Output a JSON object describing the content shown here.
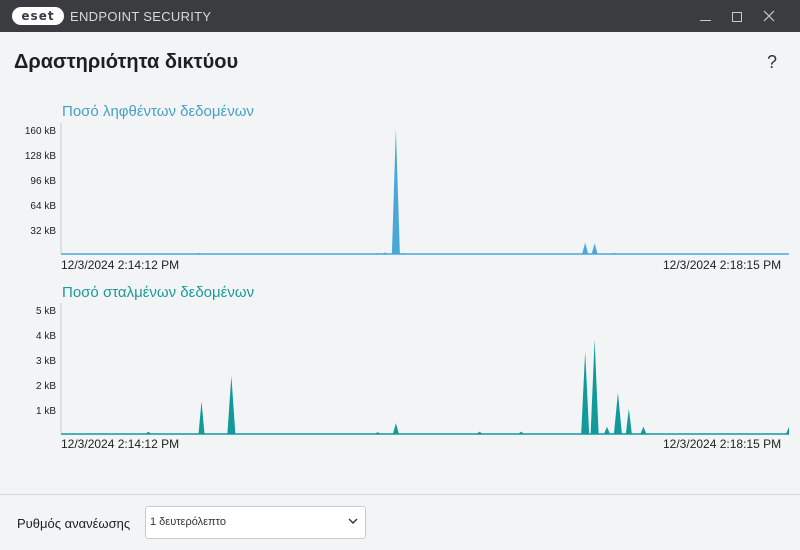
{
  "window": {
    "logo_text": "eset",
    "app_title": "ENDPOINT SECURITY",
    "minimize_icon": "minimize-icon",
    "maximize_icon": "maximize-icon",
    "close_icon": "close-icon"
  },
  "page": {
    "title": "Δραστηριότητα δικτύου",
    "help_label": "?"
  },
  "charts": {
    "received": {
      "title": "Ποσό ληφθέντων δεδομένων",
      "color": "#4aa8d6",
      "y_ticks": [
        "160 kB",
        "128 kB",
        "96 kB",
        "64 kB",
        "32 kB"
      ],
      "start_time": "12/3/2024 2:14:12 PM",
      "end_time": "12/3/2024 2:18:15 PM"
    },
    "sent": {
      "title": "Ποσό σταλμένων δεδομένων",
      "color": "#12999b",
      "y_ticks": [
        "5 kB",
        "4 kB",
        "3 kB",
        "2 kB",
        "1 kB"
      ],
      "start_time": "12/3/2024 2:14:12 PM",
      "end_time": "12/3/2024 2:18:15 PM"
    }
  },
  "chart_data": [
    {
      "type": "area",
      "title": "Ποσό ληφθέντων δεδομένων",
      "unit": "kB",
      "ylim": [
        0,
        160
      ],
      "x_start": "12/3/2024 2:14:12 PM",
      "x_end": "12/3/2024 2:18:15 PM",
      "peaks": [
        {
          "t": 0.19,
          "v": 1.5
        },
        {
          "t": 0.215,
          "v": 0.8
        },
        {
          "t": 0.235,
          "v": 0.6
        },
        {
          "t": 0.295,
          "v": 0.6
        },
        {
          "t": 0.435,
          "v": 1.5
        },
        {
          "t": 0.445,
          "v": 2
        },
        {
          "t": 0.46,
          "v": 166
        },
        {
          "t": 0.47,
          "v": 1.5
        },
        {
          "t": 0.71,
          "v": 0.8
        },
        {
          "t": 0.72,
          "v": 15
        },
        {
          "t": 0.733,
          "v": 14
        },
        {
          "t": 0.76,
          "v": 1.5
        },
        {
          "t": 0.78,
          "v": 0.8
        },
        {
          "t": 0.925,
          "v": 1
        }
      ]
    },
    {
      "type": "area",
      "title": "Ποσό σταλμένων δεδομένων",
      "unit": "kB",
      "ylim": [
        0,
        5
      ],
      "x_start": "12/3/2024 2:14:12 PM",
      "x_end": "12/3/2024 2:18:15 PM",
      "peaks": [
        {
          "t": 0.12,
          "v": 0.1
        },
        {
          "t": 0.193,
          "v": 1.35
        },
        {
          "t": 0.234,
          "v": 2.4
        },
        {
          "t": 0.435,
          "v": 0.08
        },
        {
          "t": 0.46,
          "v": 0.45
        },
        {
          "t": 0.575,
          "v": 0.1
        },
        {
          "t": 0.632,
          "v": 0.1
        },
        {
          "t": 0.72,
          "v": 3.4
        },
        {
          "t": 0.733,
          "v": 3.9
        },
        {
          "t": 0.75,
          "v": 0.3
        },
        {
          "t": 0.765,
          "v": 1.7
        },
        {
          "t": 0.78,
          "v": 1.05
        },
        {
          "t": 0.8,
          "v": 0.3
        },
        {
          "t": 1.0,
          "v": 0.3
        }
      ]
    }
  ],
  "footer": {
    "refresh_label": "Ρυθμός ανανέωσης",
    "refresh_value": "1 δευτερόλεπτο",
    "dropdown_icon": "chevron-down-icon"
  }
}
